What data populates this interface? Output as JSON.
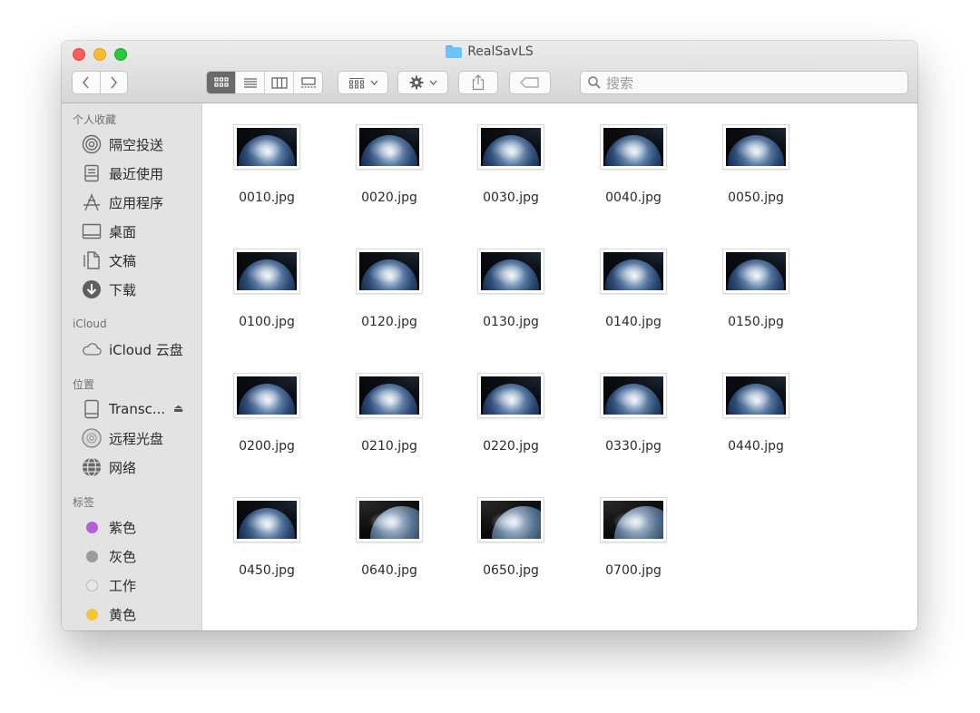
{
  "window": {
    "title": "RealSavLS"
  },
  "toolbar": {
    "search_placeholder": "搜索",
    "icons": [
      "chevron-left-icon",
      "chevron-right-icon",
      "icon-view-icon",
      "list-view-icon",
      "column-view-icon",
      "gallery-view-icon",
      "arrange-icon",
      "gear-icon",
      "share-icon",
      "tag-icon",
      "search-icon"
    ]
  },
  "sidebar": {
    "favorites_title": "个人收藏",
    "favorites": [
      {
        "label": "隔空投送",
        "icon": "airdrop-icon"
      },
      {
        "label": "最近使用",
        "icon": "recents-icon"
      },
      {
        "label": "应用程序",
        "icon": "applications-icon"
      },
      {
        "label": "桌面",
        "icon": "desktop-icon"
      },
      {
        "label": "文稿",
        "icon": "documents-icon"
      },
      {
        "label": "下载",
        "icon": "downloads-icon"
      }
    ],
    "icloud_title": "iCloud",
    "icloud": [
      {
        "label": "iCloud 云盘",
        "icon": "cloud-icon"
      }
    ],
    "locations_title": "位置",
    "locations": [
      {
        "label": "Transc...",
        "icon": "disk-icon"
      },
      {
        "label": "远程光盘",
        "icon": "optical-disc-icon"
      },
      {
        "label": "网络",
        "icon": "network-icon"
      }
    ],
    "tags_title": "标签",
    "tags": [
      {
        "label": "紫色",
        "color": "#b35fd6"
      },
      {
        "label": "灰色",
        "color": "#9a9a9a"
      },
      {
        "label": "工作",
        "color": "#e2e2e2"
      },
      {
        "label": "黄色",
        "color": "#f6c437"
      }
    ]
  },
  "files": [
    "0010.jpg",
    "0020.jpg",
    "0030.jpg",
    "0040.jpg",
    "0050.jpg",
    "0100.jpg",
    "0120.jpg",
    "0130.jpg",
    "0140.jpg",
    "0150.jpg",
    "0200.jpg",
    "0210.jpg",
    "0220.jpg",
    "0330.jpg",
    "0440.jpg",
    "0450.jpg",
    "0640.jpg",
    "0650.jpg",
    "0700.jpg"
  ]
}
